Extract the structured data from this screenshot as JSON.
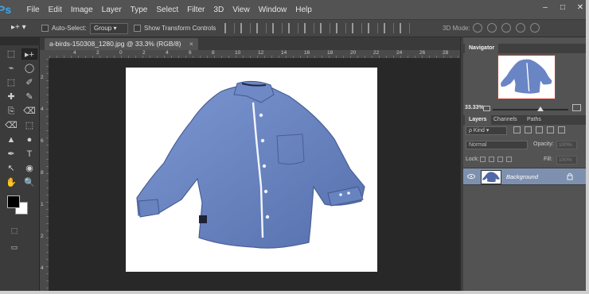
{
  "app": {
    "logo": "Ps"
  },
  "menu": [
    "File",
    "Edit",
    "Image",
    "Layer",
    "Type",
    "Select",
    "Filter",
    "3D",
    "View",
    "Window",
    "Help"
  ],
  "window_controls": [
    "–",
    "□",
    "✕"
  ],
  "options_bar": {
    "tool_icon": "move-tool-icon",
    "auto_select_label": "Auto-Select:",
    "auto_select_target": "Group",
    "show_transform_label": "Show Transform Controls",
    "mode_3d_label": "3D Mode:"
  },
  "document": {
    "tab_title": "a-birds-150308_1280.jpg @ 33.3% (RGB/8)",
    "tab_close": "×",
    "ruler_h_ticks": [
      "4",
      "2",
      "0",
      "2",
      "4",
      "6",
      "8",
      "10",
      "12",
      "14",
      "16",
      "18",
      "20",
      "22",
      "24",
      "26",
      "28"
    ],
    "ruler_v_ticks": [
      "2",
      "4",
      "6",
      "8",
      "1",
      "2",
      "4"
    ],
    "accent_shirt": "#6a85c4"
  },
  "tools": [
    "▸+",
    "⬚",
    "◯",
    "⌁",
    "⬚",
    "✐",
    "✎",
    "⌫",
    "✚",
    "⎘",
    "▲",
    "◐",
    "●",
    "◉",
    "✒",
    "T",
    "↖",
    "▭",
    "✋",
    "🔍"
  ],
  "navigator": {
    "tab": "Navigator",
    "zoom": "33.33%"
  },
  "layers": {
    "tabs": [
      "Layers",
      "Channels",
      "Paths"
    ],
    "kind_filter": "ρ Kind",
    "blend_mode": "Normal",
    "opacity_label": "Opacity:",
    "opacity_value": "100%",
    "lock_label": "Lock:",
    "fill_label": "Fill:",
    "fill_value": "100%",
    "layer_name": "Background"
  }
}
